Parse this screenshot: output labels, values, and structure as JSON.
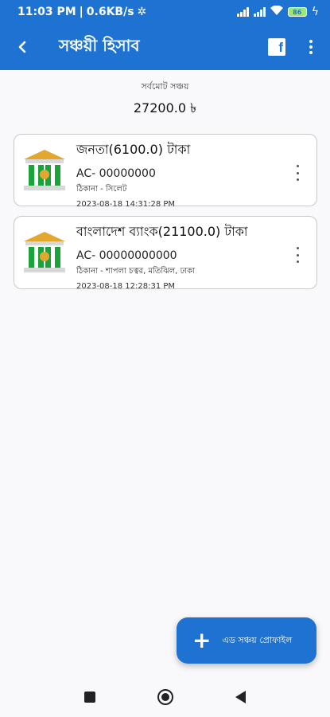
{
  "status_bar": {
    "time": "11:03 PM",
    "speed": "0.6KB/s",
    "battery": "86"
  },
  "app_bar": {
    "back_icon": "back-arrow-icon",
    "title": "সঞ্চয়ী হিসাব",
    "facebook_icon": "facebook-icon",
    "facebook_glyph": "f",
    "menu_icon": "more-vert-icon"
  },
  "summary": {
    "label": "সর্বমোট সঞ্চয়",
    "value": "27200.0 ৳"
  },
  "accounts": [
    {
      "name": "জনতা(6100.0) টাকা",
      "ac": "AC- 00000000",
      "address": "ঠিকানা - সিলেট",
      "date": "2023-08-18 14:31:28 PM",
      "icon": "bank-building-icon"
    },
    {
      "name": "বাংলাদেশ ব্যাংক(21100.0) টাকা",
      "ac": "AC- 00000000000",
      "address": "ঠিকানা - শাপলা চত্বর, মতিঝিল, ঢাকা",
      "date": "2023-08-18 12:28:31 PM",
      "icon": "bank-building-icon"
    }
  ],
  "fab": {
    "icon": "plus-icon",
    "plus_glyph": "+",
    "label": "এড সঞ্চয় প্রোফাইল"
  },
  "colors": {
    "primary": "#1e73d2",
    "bank_green": "#1aa33a",
    "bank_gold": "#e2a72e"
  }
}
